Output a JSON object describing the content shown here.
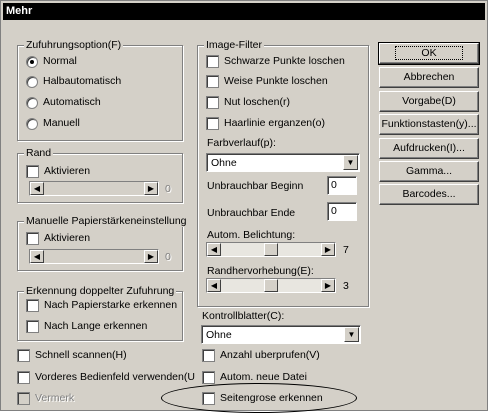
{
  "window": {
    "title": "Mehr"
  },
  "feeding": {
    "label": "Zufuhrungsoption(F)",
    "options": [
      {
        "label": "Normal",
        "selected": true
      },
      {
        "label": "Halbautomatisch",
        "selected": false
      },
      {
        "label": "Automatisch",
        "selected": false
      },
      {
        "label": "Manuell",
        "selected": false
      }
    ]
  },
  "border": {
    "label": "Rand",
    "activate": "Aktivieren",
    "value": "0"
  },
  "paper_thickness": {
    "label": "Manuelle  Papierstärkeneinstellung",
    "activate": "Aktivieren",
    "value": "0"
  },
  "double_feed": {
    "label": "Erkennung doppelter Zufuhrung",
    "options": [
      "Nach Papierstarke erkennen",
      "Nach Lange erkennen"
    ]
  },
  "bottom_left": [
    {
      "label": "Schnell scannen(H)",
      "disabled": false
    },
    {
      "label": "Vorderes Bedienfeld verwenden(U",
      "disabled": false
    },
    {
      "label": "Vermerk",
      "disabled": true
    }
  ],
  "image_filter": {
    "label": "Image-Filter",
    "options": [
      "Schwarze Punkte loschen",
      "Weise Punkte loschen",
      "Nut loschen(r)",
      "Haarlinie erganzen(o)"
    ],
    "gradient_label": "Farbverlauf(p):",
    "gradient_value": "Ohne",
    "unusable_start_label": "Unbrauchbar Beginn",
    "unusable_start_value": "0",
    "unusable_end_label": "Unbrauchbar Ende",
    "unusable_end_value": "0",
    "auto_exposure_label": "Autom. Belichtung:",
    "auto_exposure_value": "7",
    "auto_exposure_level": 0.5,
    "edge_label": "Randhervorhebung(E):",
    "edge_value": "3",
    "edge_level": 0.5
  },
  "control_sheet": {
    "label": "Kontrollblatter(C):",
    "value": "Ohne"
  },
  "bottom_right": [
    "Anzahl uberprufen(V)",
    "Autom. neue Datei",
    "Seitengrose erkennen"
  ],
  "buttons": [
    "OK",
    "Abbrechen",
    "Vorgabe(D)",
    "Funktionstasten(y)...",
    "Aufdrucken(I)...",
    "Gamma...",
    "Barcodes..."
  ]
}
